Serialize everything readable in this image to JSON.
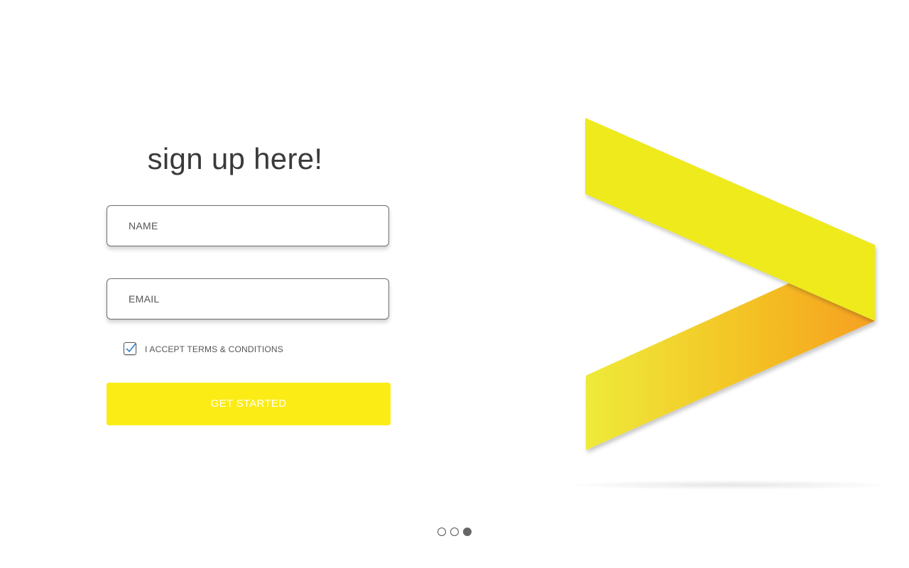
{
  "signup": {
    "title": "sign up here!",
    "name_placeholder": "NAME",
    "email_placeholder": "EMAIL",
    "terms_label": "I ACCEPT TERMS  & CONDITIONS",
    "terms_checked": true,
    "cta_label": "GET STARTED"
  },
  "carousel": {
    "total": 3,
    "active_index": 3
  },
  "colors": {
    "accent_yellow": "#fcec16",
    "logo_yellow": "#eeea1c",
    "logo_orange": "#f6a524",
    "checkbox_check": "#2f7fc8"
  },
  "icons": {
    "logo": "chevron-right-logo",
    "checkbox": "checkmark-icon"
  }
}
